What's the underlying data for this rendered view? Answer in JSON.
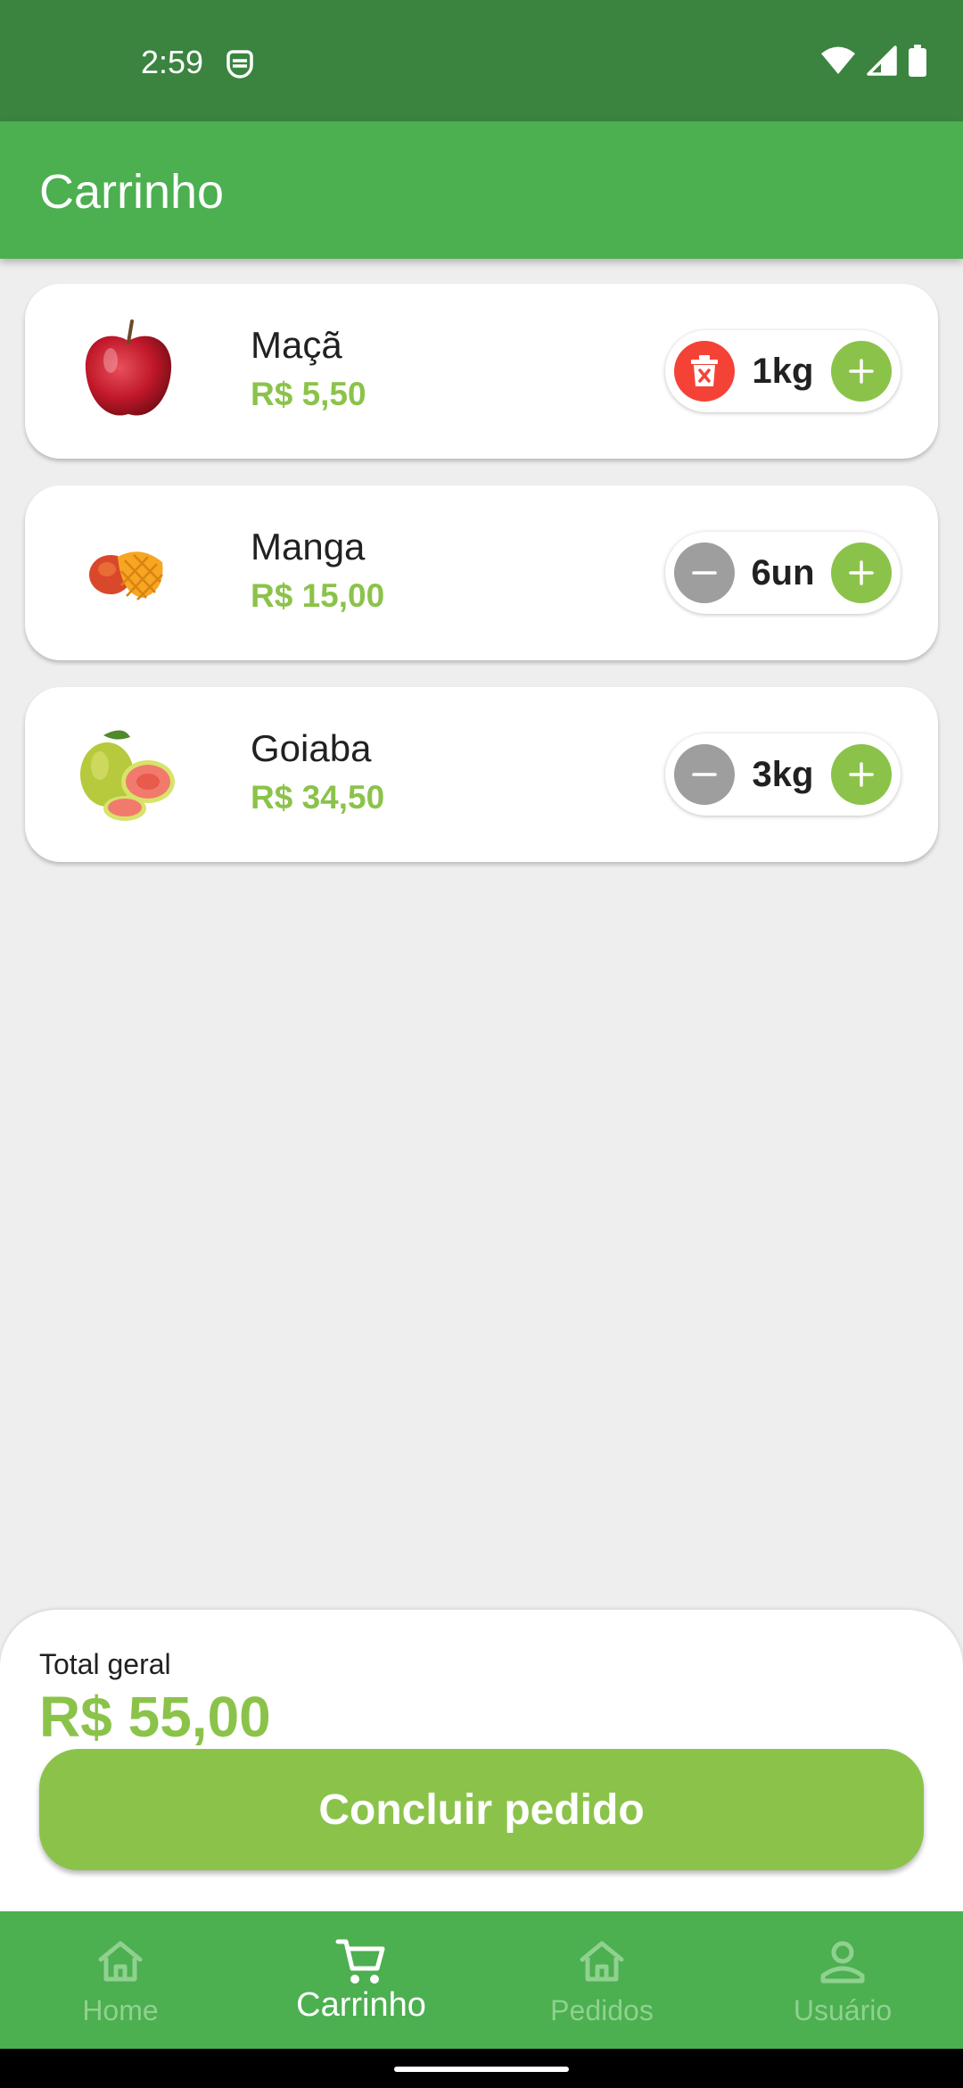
{
  "status_bar": {
    "time": "2:59",
    "icons": [
      "notification-icon",
      "wifi-icon",
      "signal-icon",
      "battery-icon"
    ]
  },
  "app_bar": {
    "title": "Carrinho"
  },
  "cart": {
    "items": [
      {
        "name": "Maçã",
        "price": "R$ 5,50",
        "quantity": "1kg",
        "image": "apple-image",
        "left_action": "delete-icon"
      },
      {
        "name": "Manga",
        "price": "R$ 15,00",
        "quantity": "6un",
        "image": "mango-image",
        "left_action": "minus-icon"
      },
      {
        "name": "Goiaba",
        "price": "R$ 34,50",
        "quantity": "3kg",
        "image": "guava-image",
        "left_action": "minus-icon"
      }
    ]
  },
  "summary": {
    "total_label": "Total geral",
    "total_value": "R$ 55,00",
    "checkout_label": "Concluir pedido"
  },
  "bottom_nav": {
    "items": [
      {
        "label": "Home",
        "icon": "home-icon",
        "active": false
      },
      {
        "label": "Carrinho",
        "icon": "cart-icon",
        "active": true
      },
      {
        "label": "Pedidos",
        "icon": "home-icon",
        "active": false
      },
      {
        "label": "Usuário",
        "icon": "user-icon",
        "active": false
      }
    ]
  },
  "colors": {
    "status_bar": "#3a8440",
    "app_bar": "#4caf50",
    "accent": "#8bc34a",
    "delete": "#f44336",
    "minus": "#9e9e9e",
    "background": "#eeeeee"
  }
}
